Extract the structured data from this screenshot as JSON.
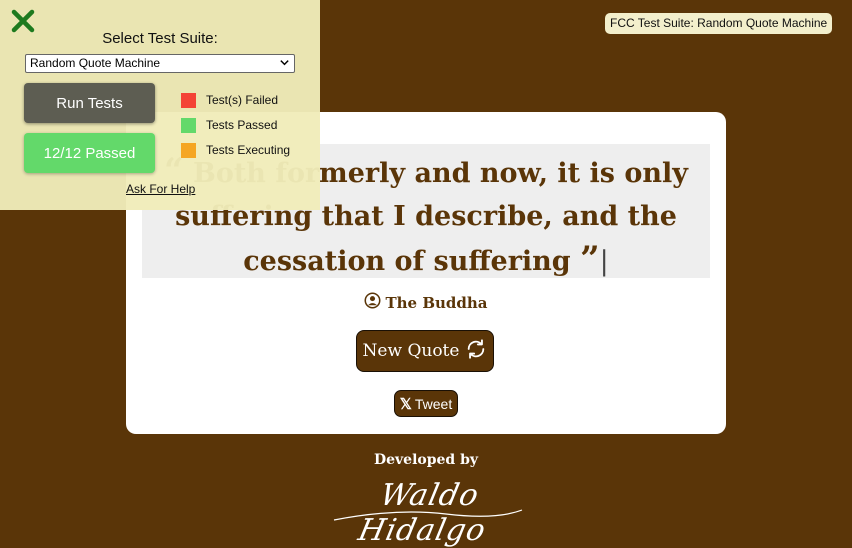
{
  "quote": {
    "open_mark": "“",
    "text": "Both formerly and now, it is only suffering that I describe, and the cessation of suffering",
    "close_mark": "”",
    "cursor": "|",
    "author": "The Buddha"
  },
  "buttons": {
    "new_quote": "New Quote",
    "tweet": "Tweet"
  },
  "footer": {
    "developed_by": "Developed by",
    "signature": "Waldo Hidalgo"
  },
  "fcc_badge": "FCC Test Suite: Random Quote Machine",
  "test_panel": {
    "select_label": "Select Test Suite:",
    "selected_suite": "Random Quote Machine",
    "run_tests": "Run Tests",
    "result": "12/12 Passed",
    "help_link": "Ask For Help",
    "legend": [
      {
        "label": "Test(s) Failed",
        "color": "#f44336"
      },
      {
        "label": "Tests Passed",
        "color": "#63d96a"
      },
      {
        "label": "Tests Executing",
        "color": "#f5a623"
      }
    ]
  },
  "colors": {
    "background": "#5a3508",
    "accent": "#5a3508",
    "card": "#ffffff",
    "panel": "#f0ecb9"
  },
  "icons": {
    "close": "close-x-icon",
    "author": "user-circle-icon",
    "refresh": "refresh-icon",
    "tweet": "x-logo-icon"
  }
}
